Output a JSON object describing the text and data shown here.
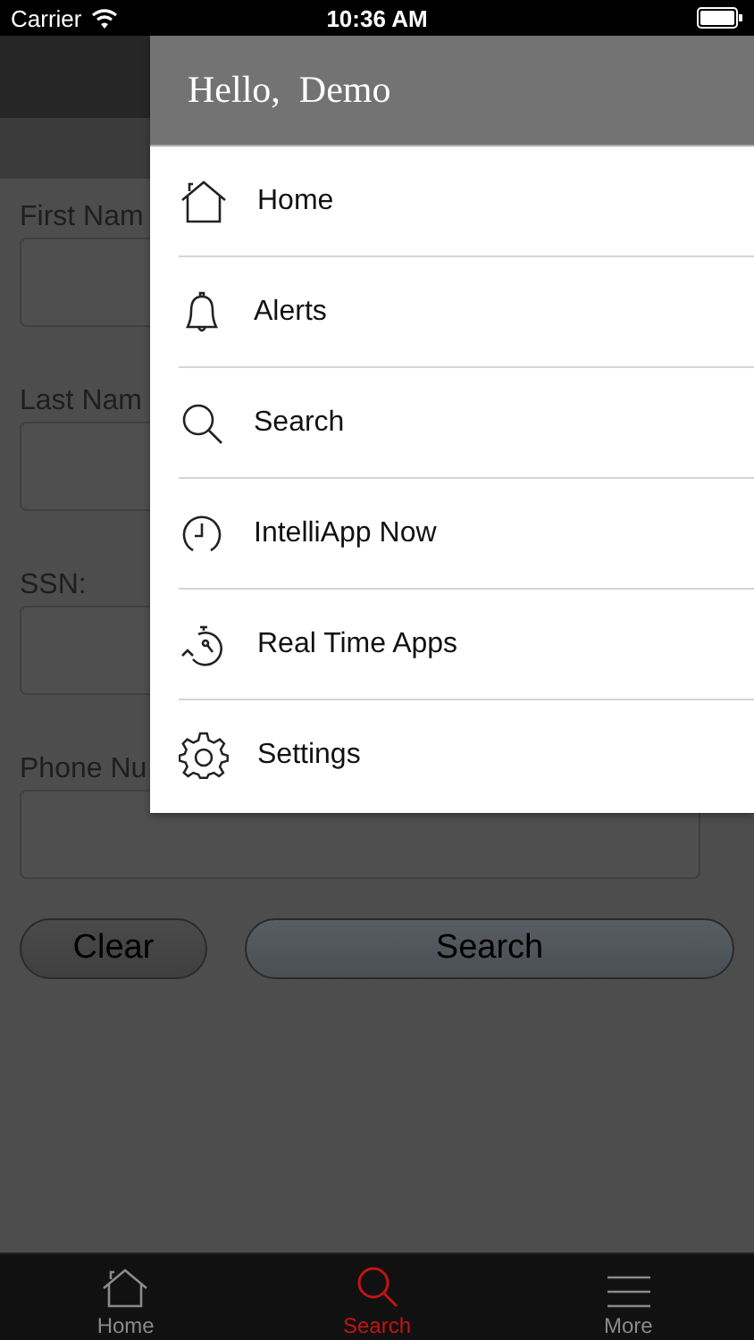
{
  "status_bar": {
    "carrier": "Carrier",
    "time": "10:36 AM"
  },
  "form": {
    "fields": [
      {
        "label": "First Nam"
      },
      {
        "label": "Last Nam"
      },
      {
        "label": "SSN:"
      },
      {
        "label": "Phone Nu"
      }
    ],
    "buttons": [
      {
        "label": "Clear",
        "kind": "secondary"
      },
      {
        "label": "Search",
        "kind": "primary"
      }
    ]
  },
  "drawer": {
    "greeting": "Hello,  Demo",
    "items": [
      {
        "label": "Home"
      },
      {
        "label": "Alerts"
      },
      {
        "label": "Search"
      },
      {
        "label": "IntelliApp Now"
      },
      {
        "label": "Real Time Apps"
      },
      {
        "label": "Settings"
      }
    ]
  },
  "tab_bar": [
    {
      "label": "Home",
      "selected": false
    },
    {
      "label": "Search",
      "selected": true
    },
    {
      "label": "More",
      "selected": false
    }
  ]
}
